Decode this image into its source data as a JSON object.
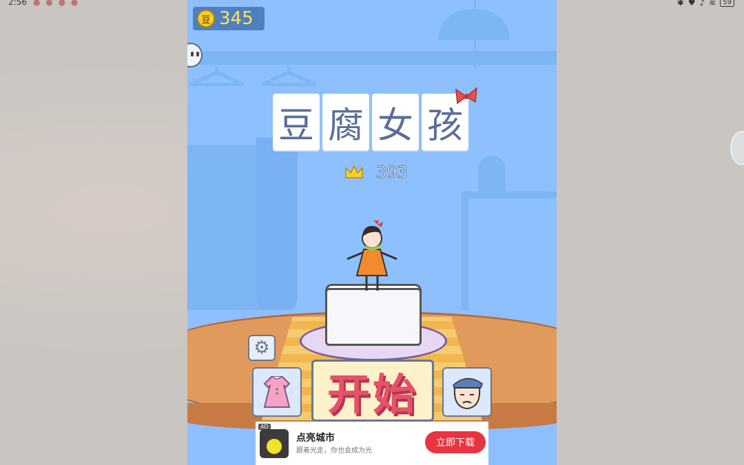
{
  "status_bar": {
    "time": "2:56",
    "battery": "59"
  },
  "game": {
    "coins": "345",
    "title_chars": [
      "豆",
      "腐",
      "女",
      "孩"
    ],
    "best_score": "393",
    "start_label": "开始",
    "icons": {
      "coin": "coin-icon",
      "crown": "crown-icon",
      "settings": "gear-icon",
      "dress": "dress-icon",
      "boss": "boss-face-icon",
      "helper": "robot-icon"
    },
    "colors": {
      "sky": "#8ec0ff",
      "start_text": "#e5526a",
      "coin_text": "#ffe45a"
    }
  },
  "ad": {
    "tag": "AD",
    "title": "点亮城市",
    "subtitle": "跟着光走，你也会成为光",
    "button": "立即下载"
  }
}
